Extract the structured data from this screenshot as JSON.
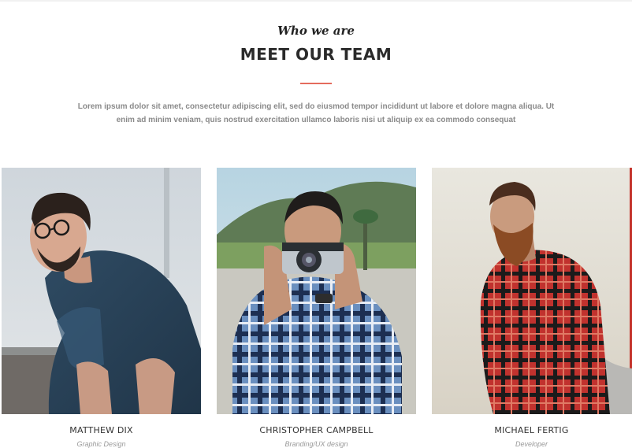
{
  "section": {
    "kicker": "Who we are",
    "title": "MEET OUR TEAM",
    "intro": "Lorem ipsum dolor sit amet, consectetur adipiscing elit, sed do eiusmod tempor incididunt ut labore et dolore magna aliqua. Ut enim ad minim veniam, quis nostrud exercitation ullamco laboris nisi ut aliquip ex ea commodo consequat",
    "accent_color": "#e46b5d"
  },
  "team": [
    {
      "name": "MATTHEW DIX",
      "role": "Graphic Design"
    },
    {
      "name": "CHRISTOPHER CAMPBELL",
      "role": "Branding/UX design"
    },
    {
      "name": "MICHAEL FERTIG",
      "role": "Developer"
    }
  ]
}
